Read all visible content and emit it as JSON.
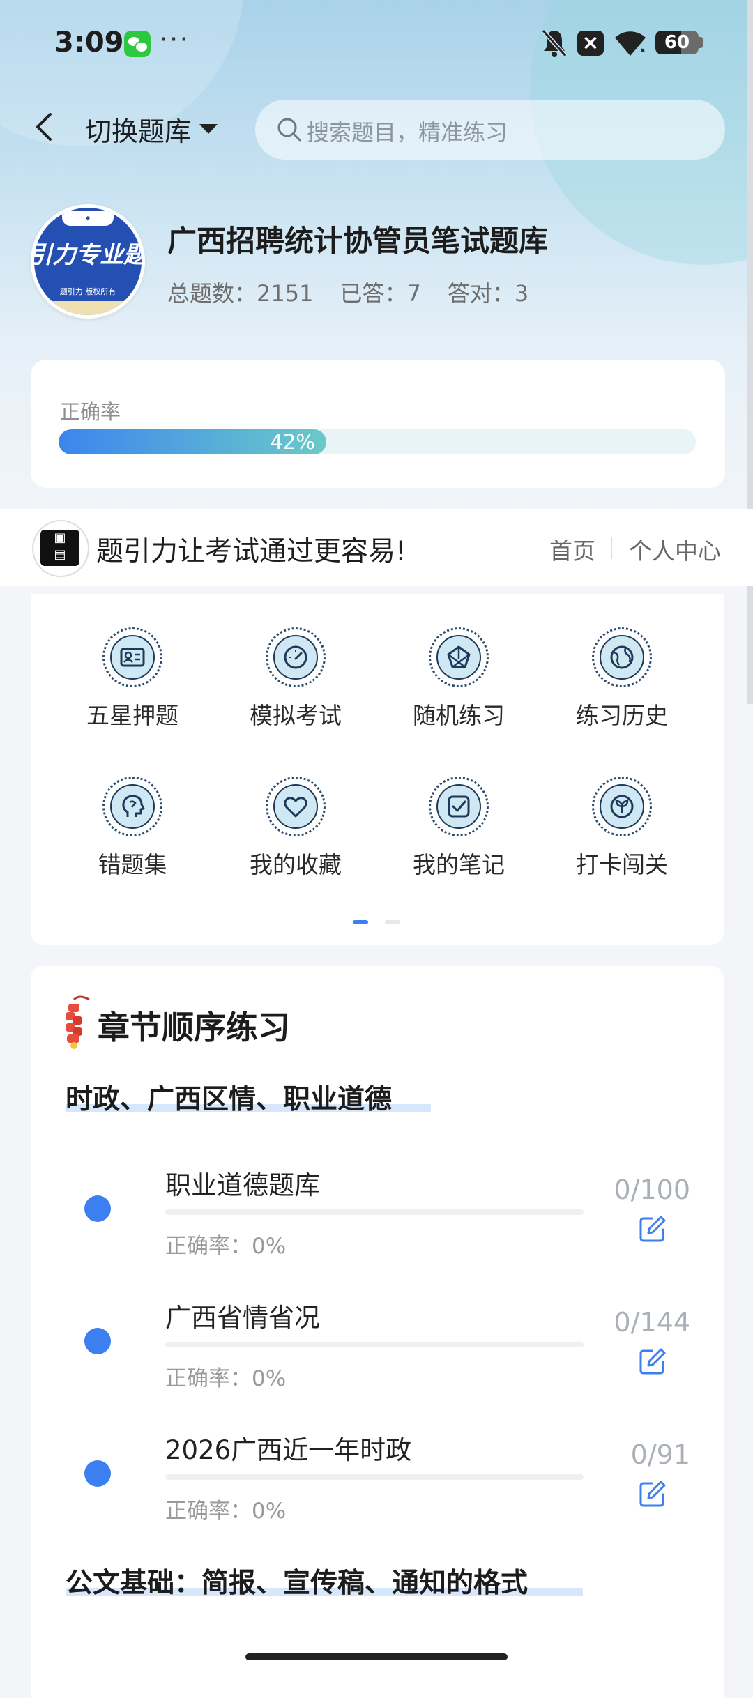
{
  "status_bar": {
    "time": "3:09",
    "battery": "60",
    "battery_level": 0.6
  },
  "header": {
    "switch_label": "切换题库",
    "search_placeholder": "搜索题目，精准练习"
  },
  "bank": {
    "logo_text": "引力专业题",
    "logo_sub": "题引力 版权所有",
    "title": "广西招聘统计协管员笔试题库",
    "total": "总题数：2151",
    "answered": "已答：7",
    "correct": "答对：3"
  },
  "accuracy": {
    "label": "正确率",
    "value_text": "42%",
    "value": 0.42
  },
  "banner": {
    "slogan": "题引力让考试通过更容易!",
    "home": "首页",
    "user_center": "个人中心"
  },
  "features": [
    {
      "label": "五星押题",
      "icon": "id-card-icon"
    },
    {
      "label": "模拟考试",
      "icon": "gauge-icon"
    },
    {
      "label": "随机练习",
      "icon": "network-icon"
    },
    {
      "label": "练习历史",
      "icon": "globe-icon"
    },
    {
      "label": "错题集",
      "icon": "head-icon"
    },
    {
      "label": "我的收藏",
      "icon": "heart-icon"
    },
    {
      "label": "我的笔记",
      "icon": "note-check-icon"
    },
    {
      "label": "打卡闯关",
      "icon": "sprout-icon"
    }
  ],
  "chapters": {
    "title": "章节顺序练习",
    "groups": [
      {
        "title": "时政、广西区情、职业道德",
        "items": [
          {
            "name": "职业道德题库",
            "accuracy": "正确率：0%",
            "count": "0/100",
            "progress": 0
          },
          {
            "name": "广西省情省况",
            "accuracy": "正确率：0%",
            "count": "0/144",
            "progress": 0
          },
          {
            "name": "2026广西近一年时政",
            "accuracy": "正确率：0%",
            "count": "0/91",
            "progress": 0
          }
        ]
      },
      {
        "title": "公文基础：简报、宣传稿、通知的格式"
      }
    ]
  },
  "colors": {
    "accent": "#3b7ff0",
    "progress_start": "#3b86ee",
    "progress_end": "#6bc9c8"
  }
}
